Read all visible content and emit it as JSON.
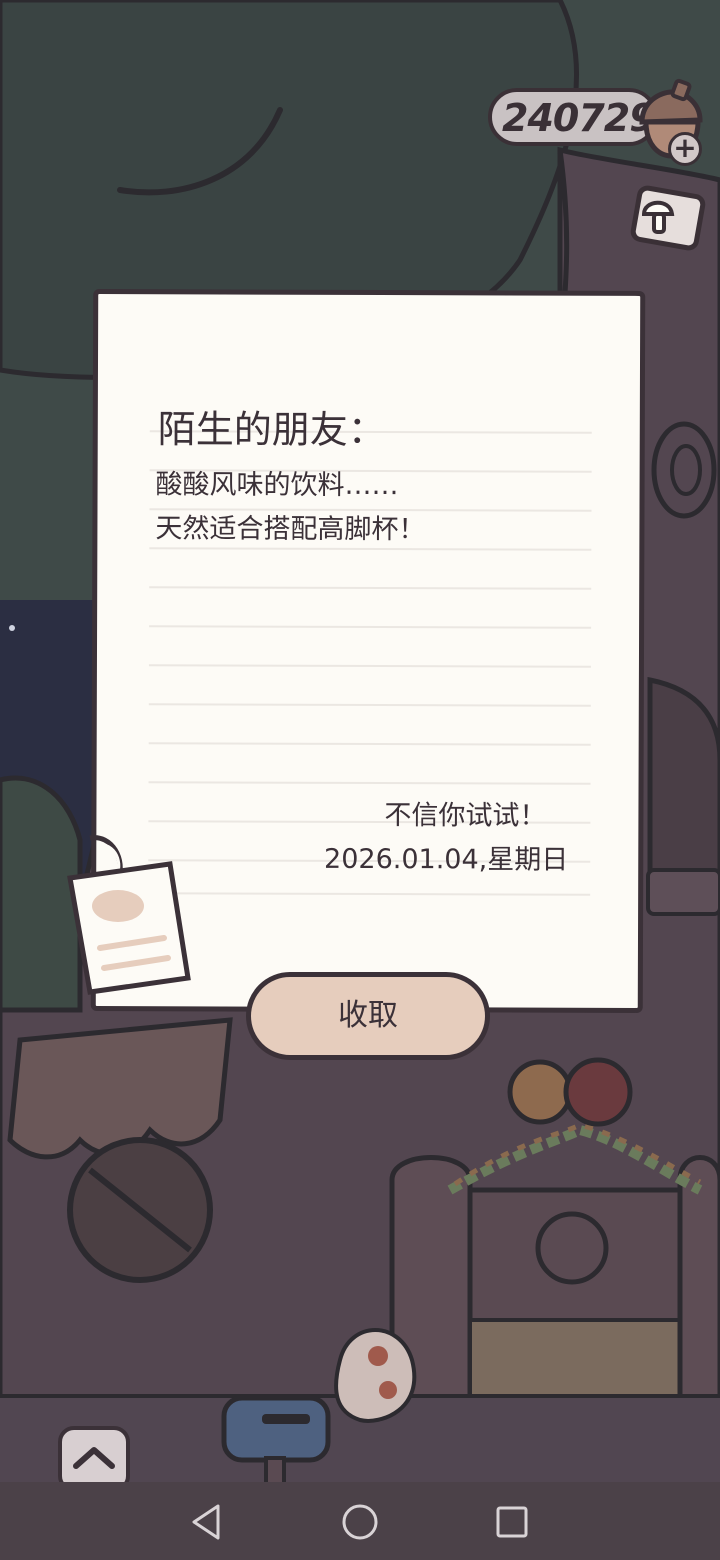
{
  "hud": {
    "currency_value": "240729",
    "currency_icon": "acorn-icon",
    "add_icon": "plus-icon",
    "mushroom_button_icon": "mushroom-icon"
  },
  "letter": {
    "greeting": "陌生的朋友：",
    "body_lines": [
      "酸酸风味的饮料……",
      "天然适合搭配高脚杯！"
    ],
    "signature": "不信你试试！",
    "date": "2026.01.04,星期日"
  },
  "actions": {
    "receive_label": "收取"
  },
  "navigation": {
    "toggle_icon": "chevron-up-icon",
    "back_icon": "back-triangle-icon",
    "home_icon": "home-circle-icon",
    "recents_icon": "recents-square-icon"
  },
  "colors": {
    "paper": "#fdfbf6",
    "ink": "#3b3138",
    "button": "#e6cdbd",
    "tree_trunk": "#5a4a52",
    "canopy": "#3f4a48"
  }
}
